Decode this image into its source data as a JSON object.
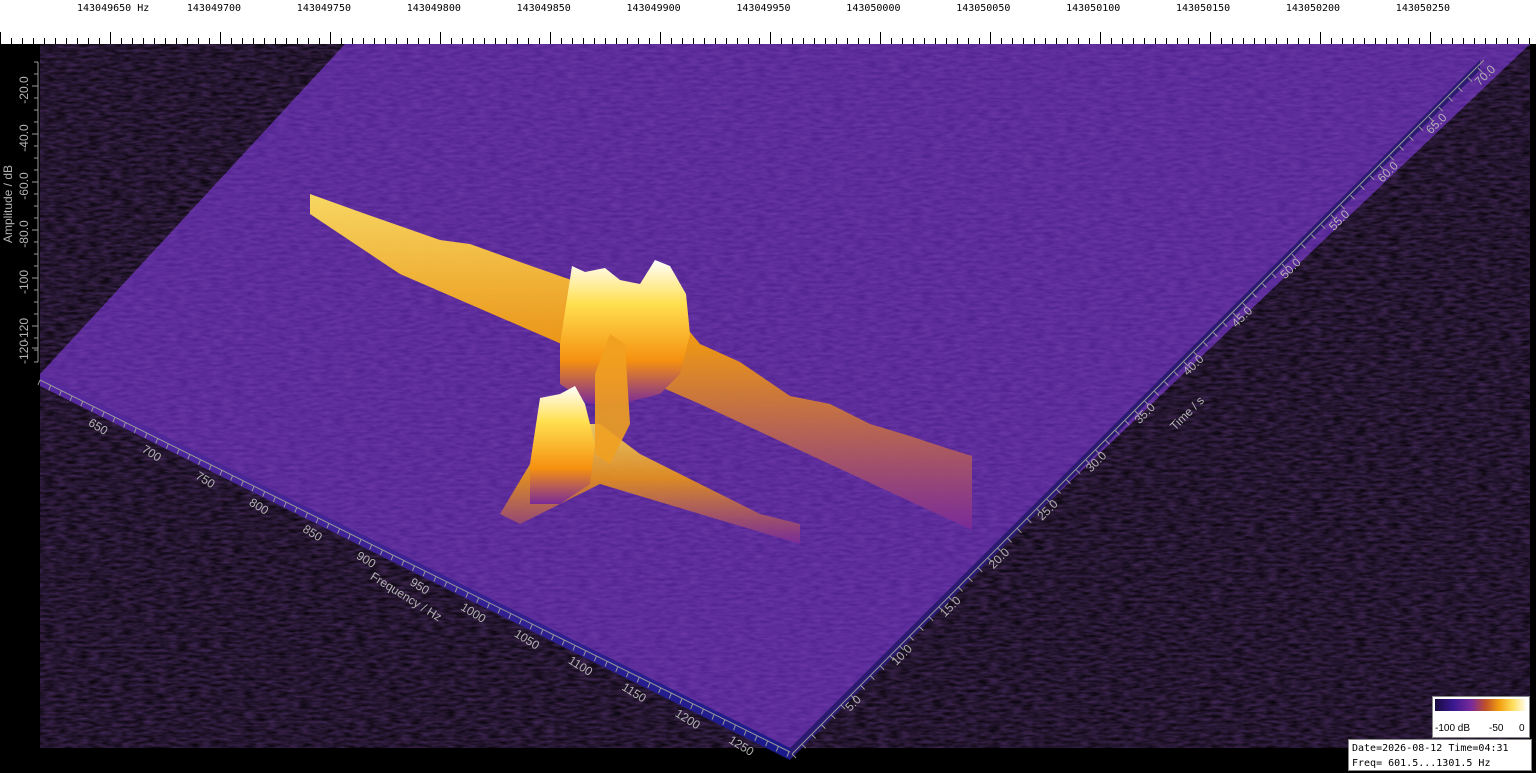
{
  "ruler": {
    "unit": "Hz",
    "labels": [
      "143049650",
      "143049700",
      "143049750",
      "143049800",
      "143049850",
      "143049900",
      "143049950",
      "143050000",
      "143050050",
      "143050100",
      "143050150",
      "143050200",
      "143050250"
    ]
  },
  "amplitude_axis": {
    "title": "Amplitude / dB",
    "ticks": [
      "-20.0",
      "-40.0",
      "-60.0",
      "-80.0",
      "-100",
      "-120",
      "-120"
    ]
  },
  "frequency_axis": {
    "title": "Frequency / Hz",
    "ticks": [
      "650",
      "700",
      "750",
      "800",
      "850",
      "900",
      "950",
      "1000",
      "1050",
      "1100",
      "1150",
      "1200",
      "1250"
    ]
  },
  "time_axis": {
    "title": "Time / s",
    "ticks": [
      "5.0",
      "10.0",
      "15.0",
      "20.0",
      "25.0",
      "30.0",
      "35.0",
      "40.0",
      "45.0",
      "50.0",
      "55.0",
      "60.0",
      "65.0",
      "70.0"
    ]
  },
  "colorbar": {
    "label_min": "-100 dB",
    "label_mid": "-50",
    "label_max": "0"
  },
  "info": {
    "line1": "Date=2026-08-12 Time=04:31",
    "line2": "Freq= 601.5...1301.5 Hz"
  },
  "colors": {
    "floor": "#4a1e8c",
    "floor_dark": "#1a1260",
    "peak": "#ffd020",
    "peak_hot": "#ffffff"
  }
}
